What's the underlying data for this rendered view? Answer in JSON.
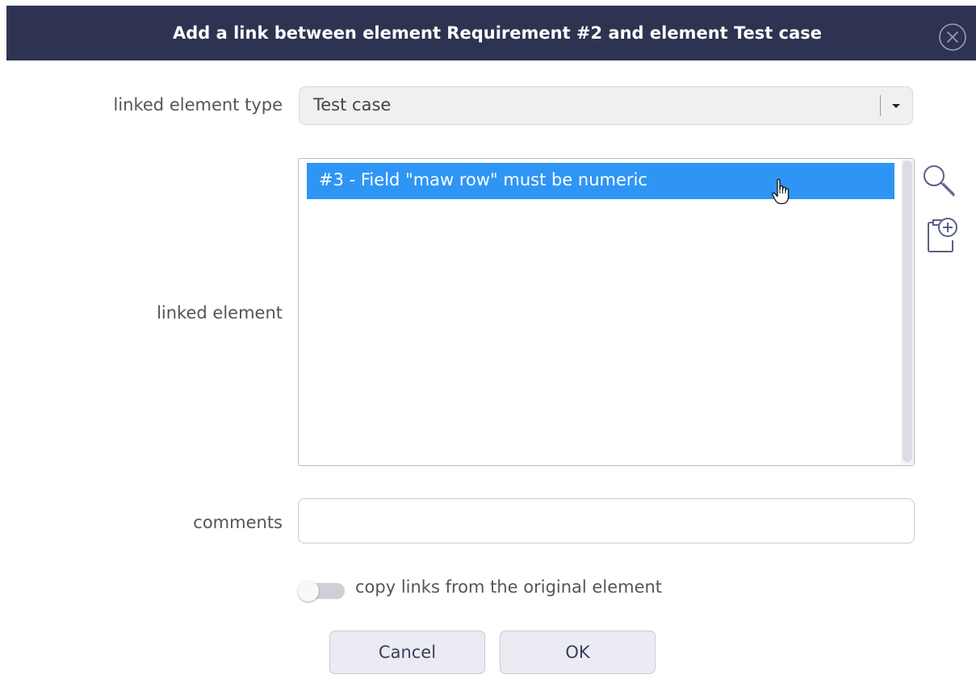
{
  "dialog": {
    "title": "Add a link between element Requirement #2 and element Test case"
  },
  "form": {
    "linked_element_type": {
      "label": "linked element type",
      "value": "Test case"
    },
    "linked_element": {
      "label": "linked element",
      "items": [
        "#3 - Field \"maw row\" must be numeric"
      ],
      "selected_index": 0
    },
    "comments": {
      "label": "comments",
      "value": ""
    },
    "copy_links": {
      "label": "copy links from the original element",
      "checked": false
    }
  },
  "buttons": {
    "cancel": "Cancel",
    "ok": "OK"
  },
  "icons": {
    "close": "close-circle-icon",
    "search": "magnifier-icon",
    "add": "add-clipboard-icon",
    "dropdown": "caret-down-icon"
  },
  "colors": {
    "titlebar": "#2f3352",
    "selection": "#2f95f5",
    "icon": "#5b5f86"
  }
}
